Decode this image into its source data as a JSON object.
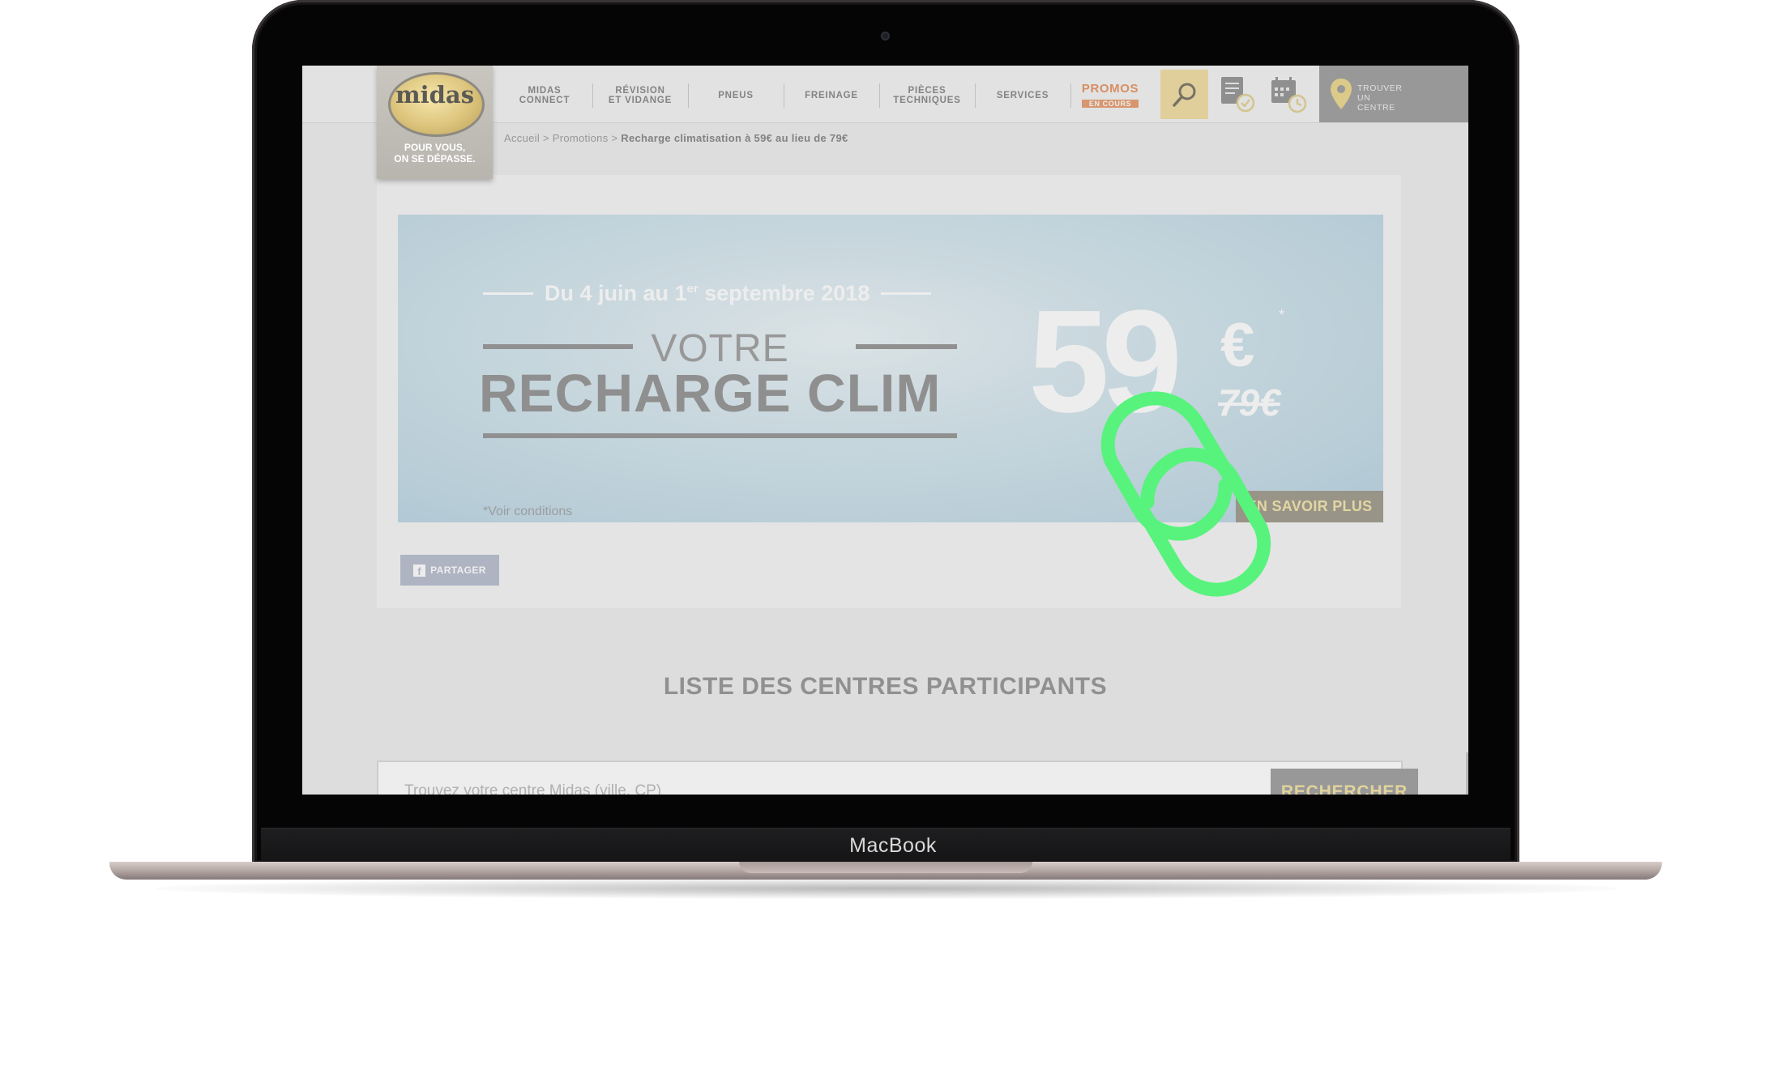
{
  "device": {
    "brand_label": "MacBook"
  },
  "site": {
    "logo": {
      "word": "midas",
      "tagline": "POUR VOUS,\nON SE DÉPASSE."
    },
    "nav": [
      {
        "label": "MIDAS\nCONNECT"
      },
      {
        "label": "RÉVISION\nET VIDANGE"
      },
      {
        "label": "PNEUS"
      },
      {
        "label": "FREINAGE"
      },
      {
        "label": "PIÈCES\nTECHNIQUES"
      },
      {
        "label": "SERVICES"
      }
    ],
    "promo": {
      "label": "PROMOS",
      "sublabel": "EN COURS"
    },
    "find_center": {
      "label": "TROUVER\nUN\nCENTRE"
    },
    "icons": {
      "search": "search-icon",
      "quote": "quote-checklist-icon",
      "appointment": "calendar-clock-icon",
      "location": "map-pin-icon"
    },
    "colors": {
      "accent_gold": "#f1dfa6",
      "promo_orange": "#e89a6a",
      "banner_blue": "#bcd7e4",
      "link_overlay_green": "#58f37c"
    }
  },
  "breadcrumb": {
    "home": "Accueil",
    "sep1": ">",
    "section": "Promotions",
    "sep2": ">",
    "current": "Recharge climatisation à 59€ au lieu de 79€"
  },
  "banner": {
    "dates_prefix": "Du 4 juin au 1",
    "dates_sup": "er",
    "dates_suffix": " septembre 2018",
    "line1": "VOTRE",
    "line2": "RECHARGE CLIM",
    "price": "59",
    "currency": "€",
    "asterisk": "*",
    "old_price": "79€",
    "conditions": "*Voir conditions",
    "cta": "EN SAVOIR PLUS"
  },
  "share": {
    "label": "PARTAGER",
    "icon_letter": "f"
  },
  "centers": {
    "title": "LISTE DES CENTRES PARTICIPANTS",
    "search_placeholder": "Trouvez votre centre Midas (ville, CP)",
    "search_button": "RECHERCHER"
  }
}
